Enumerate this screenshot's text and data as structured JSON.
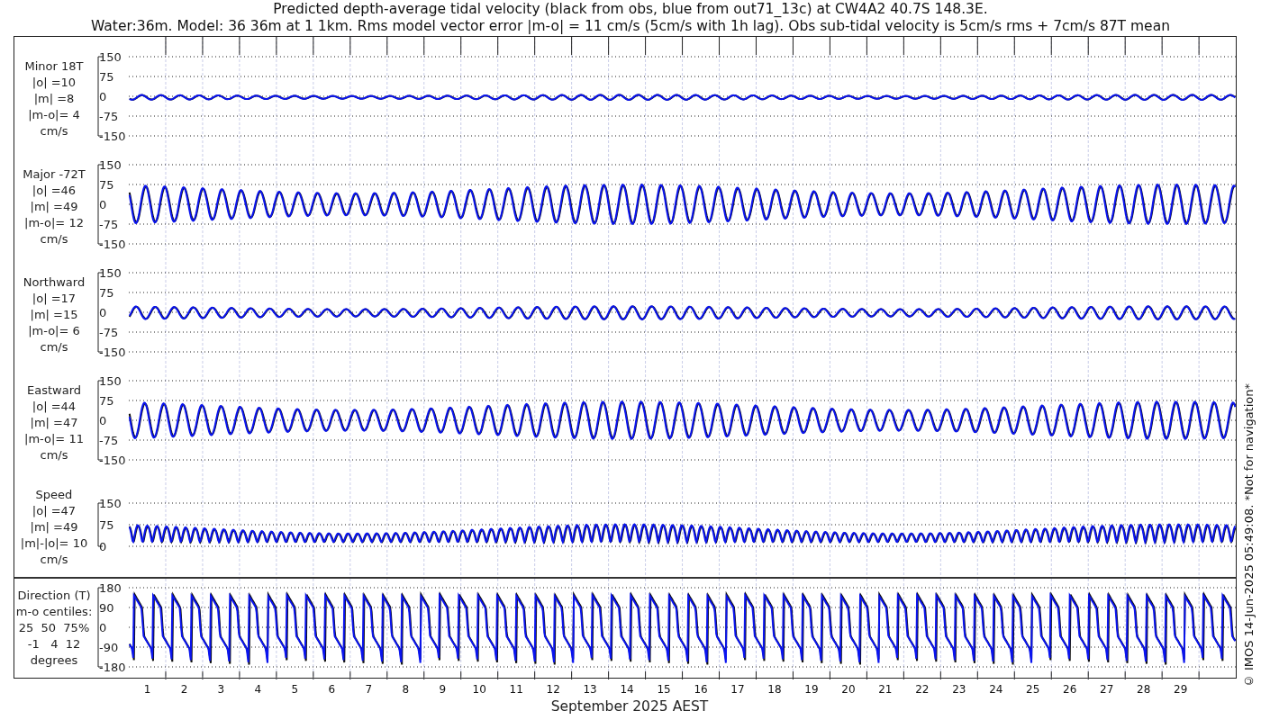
{
  "title": [
    "Predicted depth-average tidal velocity (black from obs, blue from out71_13c) at CW4A2 40.7S 148.3E.",
    "Water:36m. Model: 36 36m at 1 1km. Rms model vector error |m-o| = 11 cm/s (5cm/s with 1h lag). Obs sub-tidal velocity is 5cm/s rms + 7cm/s 87T mean"
  ],
  "panels": [
    {
      "kind": "velocity",
      "label": [
        "Minor 18T",
        "|o| =10",
        "|m| =8",
        "|m-o|= 4",
        "cm/s"
      ],
      "yticks": [
        "150",
        "75",
        "0",
        "-75",
        "-150"
      ]
    },
    {
      "kind": "velocity",
      "label": [
        "Major -72T",
        "|o| =46",
        "|m| =49",
        "|m-o|= 12",
        "cm/s"
      ],
      "yticks": [
        "150",
        "75",
        "0",
        "-75",
        "-150"
      ]
    },
    {
      "kind": "velocity",
      "label": [
        "Northward",
        "|o| =17",
        "|m| =15",
        "|m-o|= 6",
        "cm/s"
      ],
      "yticks": [
        "150",
        "75",
        "0",
        "-75",
        "-150"
      ]
    },
    {
      "kind": "velocity",
      "label": [
        "Eastward",
        "|o| =44",
        "|m| =47",
        "|m-o|= 11",
        "cm/s"
      ],
      "yticks": [
        "150",
        "75",
        "0",
        "-75",
        "-150"
      ]
    },
    {
      "kind": "speed",
      "label": [
        "Speed",
        "|o| =47",
        "|m| =49",
        "|m|-|o|= 10",
        "cm/s"
      ],
      "yticks": [
        "150",
        "75",
        "0"
      ]
    },
    {
      "kind": "direction",
      "label": [
        "Direction (T)",
        "m-o centiles:",
        "25  50  75%",
        "-1   4  12",
        "degrees"
      ],
      "yticks": [
        "180",
        "90",
        "0",
        "-90",
        "-180"
      ]
    }
  ],
  "days": [
    "1",
    "2",
    "3",
    "4",
    "5",
    "6",
    "7",
    "8",
    "9",
    "10",
    "11",
    "12",
    "13",
    "14",
    "15",
    "16",
    "17",
    "18",
    "19",
    "20",
    "21",
    "22",
    "23",
    "24",
    "25",
    "26",
    "27",
    "28",
    "29"
  ],
  "xlabel": "September 2025 AEST",
  "footer": "© IMOS 14-Jun-2025 05:49:08. *Not for navigation*"
}
